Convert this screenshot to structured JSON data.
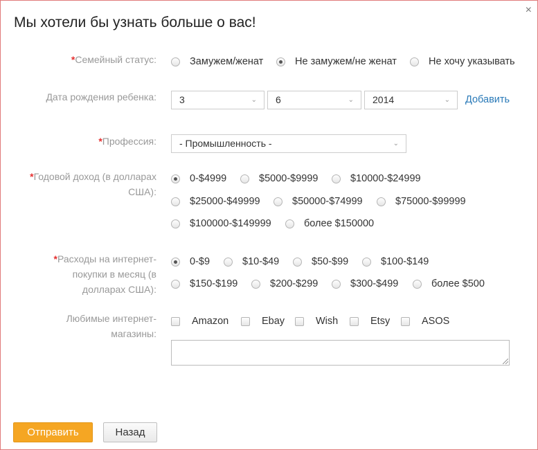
{
  "dialog": {
    "title": "Мы хотели бы узнать больше о вас!",
    "close": "×"
  },
  "marital": {
    "label": "Семейный статус:",
    "options": [
      "Замужем/женат",
      "Не замужем/не женат",
      "Не хочу указывать"
    ],
    "selected": 1
  },
  "child_birth": {
    "label": "Дата рождения ребенка:",
    "day": "3",
    "month": "6",
    "year": "2014",
    "add_link": "Добавить"
  },
  "profession": {
    "label": "Профессия:",
    "value": "- Промышленность -"
  },
  "income": {
    "label_line1": "Годовой доход (в долларах",
    "label_line2": "США):",
    "options": [
      "0-$4999",
      "$5000-$9999",
      "$10000-$24999",
      "$25000-$49999",
      "$50000-$74999",
      "$75000-$99999",
      "$100000-$149999",
      "более $150000"
    ],
    "selected": 0
  },
  "spending": {
    "label_line1": "Расходы на интернет-",
    "label_line2": "покупки в месяц (в",
    "label_line3": "долларах США):",
    "options": [
      "0-$9",
      "$10-$49",
      "$50-$99",
      "$100-$149",
      "$150-$199",
      "$200-$299",
      "$300-$499",
      "более $500"
    ],
    "selected": 0
  },
  "stores": {
    "label_line1": "Любимые интернет-",
    "label_line2": "магазины:",
    "options": [
      "Amazon",
      "Ebay",
      "Wish",
      "Etsy",
      "ASOS"
    ],
    "other_value": ""
  },
  "buttons": {
    "submit": "Отправить",
    "back": "Назад"
  },
  "colors": {
    "accent": "#f5a623",
    "required": "#e53030",
    "link": "#2a7ab8",
    "border": "#e07a7a"
  }
}
